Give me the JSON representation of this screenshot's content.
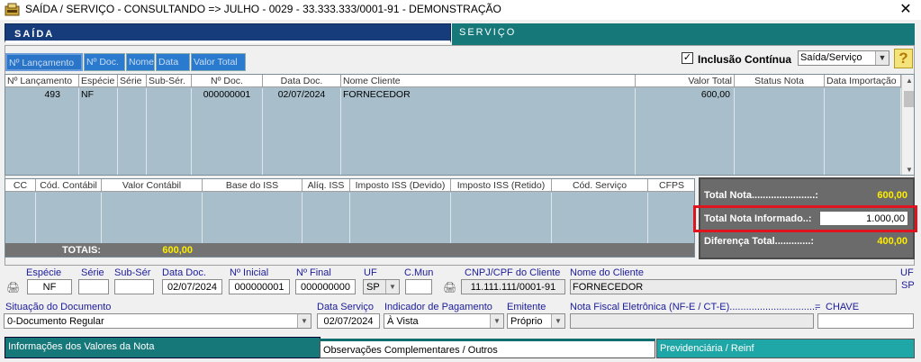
{
  "window": {
    "title": "SAÍDA / SERVIÇO  -  CONSULTANDO   =>  JULHO  -  0029 - 33.333.333/0001-91 - DEMONSTRAÇÃO"
  },
  "tabs": {
    "saida": "SAÍDA",
    "servico": "SERVIÇO"
  },
  "sort_buttons": [
    "Nº Lançamento",
    "Nº Doc.",
    "Nome",
    "Data",
    "Valor Total"
  ],
  "inclusao": {
    "label": "Inclusão Contínua",
    "checked": "✓"
  },
  "tipo_select": "Saída/Serviço",
  "help": "?",
  "grid1": {
    "headers": [
      "Nº Lançamento",
      "Espécie",
      "Série",
      "Sub-Sér.",
      "Nº Doc.",
      "Data Doc.",
      "Nome Cliente",
      "Valor Total",
      "Status Nota",
      "Data Importação"
    ],
    "rows": [
      [
        "493",
        "NF",
        "",
        "",
        "000000001",
        "02/07/2024",
        "FORNECEDOR",
        "600,00",
        "",
        ""
      ]
    ]
  },
  "grid2": {
    "headers": [
      "CC",
      "Cód. Contábil",
      "Valor Contábil",
      "Base do ISS",
      "Alíq. ISS",
      "Imposto ISS (Devido)",
      "Imposto ISS (Retido)",
      "Cód. Serviço",
      "CFPS"
    ],
    "totais_label": "TOTAIS:",
    "totais_value": "600,00"
  },
  "totals": {
    "total_nota_label": "Total Nota.......................:",
    "total_nota_value": "600,00",
    "informado_label": "Total Nota Informado..:",
    "informado_value": "1.000,00",
    "diferenca_label": "Diferença Total.............:",
    "diferenca_value": "400,00"
  },
  "form": {
    "especie": {
      "label": "Espécie",
      "value": "NF"
    },
    "serie": {
      "label": "Série",
      "value": ""
    },
    "sub_ser": {
      "label": "Sub-Sér",
      "value": ""
    },
    "data_doc": {
      "label": "Data Doc.",
      "value": "02/07/2024"
    },
    "n_inicial": {
      "label": "Nº Inicial",
      "value": "000000001"
    },
    "n_final": {
      "label": "Nº Final",
      "value": "000000000"
    },
    "uf": {
      "label": "UF",
      "value": "SP"
    },
    "cmun": {
      "label": "C.Mun",
      "value": ""
    },
    "cnpj": {
      "label": "CNPJ/CPF do Cliente",
      "value": "11.111.111/0001-91"
    },
    "nome_cliente": {
      "label": "Nome do Cliente",
      "value": "FORNECEDOR"
    },
    "uf2": {
      "label": "UF",
      "value": "SP"
    },
    "situacao": {
      "label": "Situação do Documento",
      "value": "0-Documento Regular"
    },
    "data_servico": {
      "label": "Data Serviço",
      "value": "02/07/2024"
    },
    "indicador": {
      "label": "Indicador de Pagamento",
      "value": "À Vista"
    },
    "emitente": {
      "label": "Emitente",
      "value": "Próprio"
    },
    "nfe": {
      "label": "Nota Fiscal Eletrônica (NF-E / CT-E)................................",
      "eq": "=",
      "chave": "CHAVE"
    }
  },
  "bottom_tabs": [
    "Informações dos Valores da Nota",
    "Observações Complementares / Outros",
    "Previdenciária / Reinf"
  ],
  "colors": {
    "navy": "#173c7c",
    "teal": "#17787a",
    "grid": "#a8bfcb",
    "highlight": "#e0141e",
    "total_yellow": "#ffee00"
  }
}
